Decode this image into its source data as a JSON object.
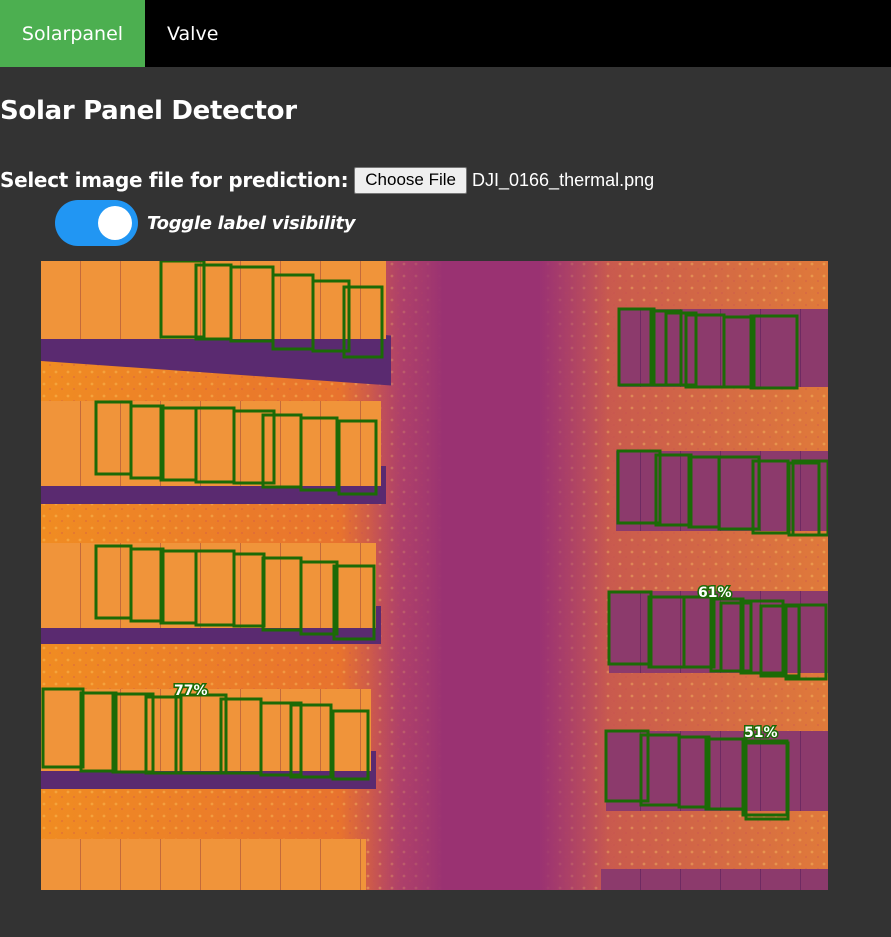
{
  "nav": {
    "tabs": [
      {
        "label": "Solarpanel",
        "active": true
      },
      {
        "label": "Valve",
        "active": false
      }
    ],
    "active_color": "#4caf50",
    "background": "#000000"
  },
  "page": {
    "title": "Solar Panel Detector"
  },
  "file_input": {
    "label": "Select image file for prediction:",
    "button_label": "Choose File",
    "file_name": "DJI_0166_thermal.png"
  },
  "toggle": {
    "label": "Toggle label visibility",
    "on": true,
    "color": "#2196f3"
  },
  "detections": {
    "box_color": "#1b6a06",
    "labels": [
      "61%",
      "77%",
      "51%"
    ]
  }
}
